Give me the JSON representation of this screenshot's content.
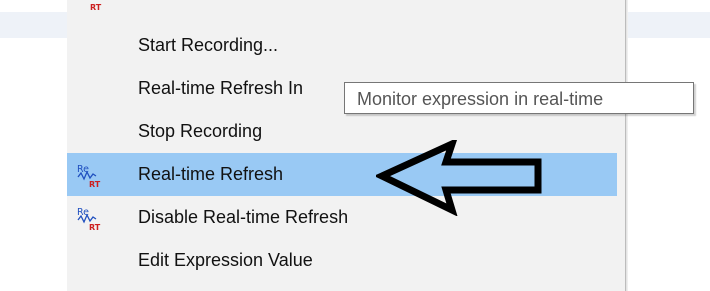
{
  "menu": {
    "items": [
      {
        "label": "Start Recording...",
        "icon": null,
        "highlighted": false
      },
      {
        "label": "Real-time Refresh In",
        "icon": null,
        "highlighted": false
      },
      {
        "label": "Stop Recording",
        "icon": null,
        "highlighted": false
      },
      {
        "label": "Real-time Refresh",
        "icon": "realtime-refresh-icon",
        "highlighted": true
      },
      {
        "label": "Disable Real-time Refresh",
        "icon": "realtime-refresh-icon",
        "highlighted": false
      },
      {
        "label": "Edit Expression Value",
        "icon": null,
        "highlighted": false
      }
    ],
    "top_icon_text": "RT",
    "icon_text": {
      "re": "Re",
      "rt": "RT"
    }
  },
  "tooltip": {
    "text": "Monitor expression in real-time"
  },
  "annotation": {
    "icon": "left-arrow-icon",
    "color": "#000000"
  },
  "colors": {
    "highlight": "#99c9f4",
    "menu_bg": "#f2f2f2",
    "rt_red": "#cc1f1f",
    "re_blue": "#1f4fbf"
  }
}
